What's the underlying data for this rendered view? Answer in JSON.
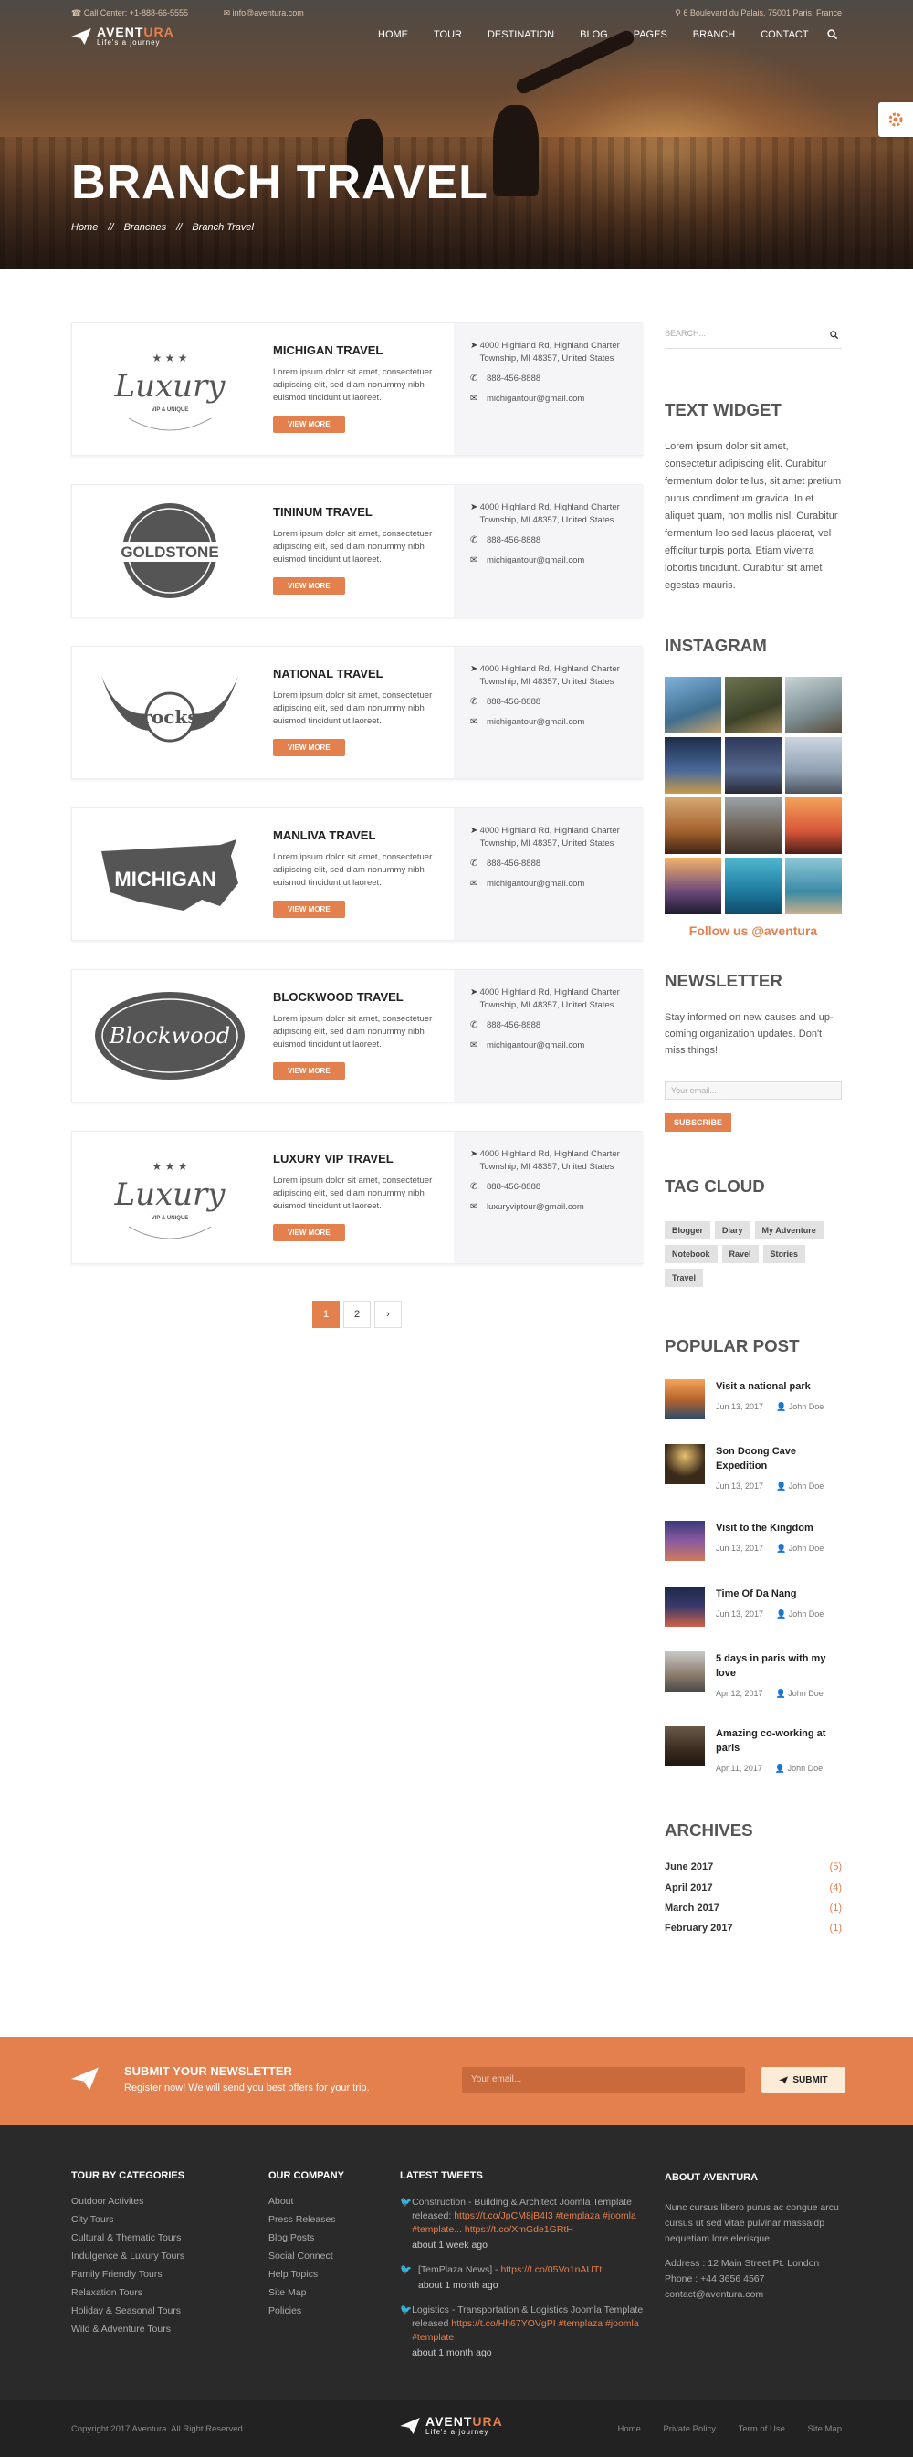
{
  "topbar": {
    "call": "Call Center: +1-888-66-5555",
    "email": "info@aventura.com",
    "address": "6 Boulevard du Palais, 75001 Paris, France"
  },
  "brand": {
    "name_a": "AVENT",
    "name_b": "URA",
    "tagline": "Life's a journey"
  },
  "menu": [
    "HOME",
    "TOUR",
    "DESTINATION",
    "BLOG",
    "PAGES",
    "BRANCH",
    "CONTACT"
  ],
  "hero": {
    "title": "BRANCH TRAVEL",
    "breadcrumb": [
      "Home",
      "//",
      "Branches",
      "//",
      "Branch Travel"
    ]
  },
  "branches": [
    {
      "name": "MICHIGAN TRAVEL",
      "logo": "Luxury",
      "desc": "Lorem ipsum dolor sit amet, consectetuer adipiscing elit, sed diam nonummy nibh euismod tincidunt ut laoreet.",
      "button": "VIEW MORE",
      "address": "4000 Highland Rd, Highland Charter Township, MI 48357, United States",
      "phone": "888-456-8888",
      "email": "michigantour@gmail.com"
    },
    {
      "name": "TININUM TRAVEL",
      "logo": "GOLDSTONE",
      "desc": "Lorem ipsum dolor sit amet, consectetuer adipiscing elit, sed diam nonummy nibh euismod tincidunt ut laoreet.",
      "button": "VIEW MORE",
      "address": "4000 Highland Rd, Highland Charter Township, MI 48357, United States",
      "phone": "888-456-8888",
      "email": "michigantour@gmail.com"
    },
    {
      "name": "NATIONAL TRAVEL",
      "logo": "rocks",
      "desc": "Lorem ipsum dolor sit amet, consectetuer adipiscing elit, sed diam nonummy nibh euismod tincidunt ut laoreet.",
      "button": "VIEW MORE",
      "address": "4000 Highland Rd, Highland Charter Township, MI 48357, United States",
      "phone": "888-456-8888",
      "email": "michigantour@gmail.com"
    },
    {
      "name": "MANLIVA TRAVEL",
      "logo": "MICHIGAN",
      "desc": "Lorem ipsum dolor sit amet, consectetuer adipiscing elit, sed diam nonummy nibh euismod tincidunt ut laoreet.",
      "button": "VIEW MORE",
      "address": "4000 Highland Rd, Highland Charter Township, MI 48357, United States",
      "phone": "888-456-8888",
      "email": "michigantour@gmail.com"
    },
    {
      "name": "BLOCKWOOD TRAVEL",
      "logo": "Blockwood",
      "desc": "Lorem ipsum dolor sit amet, consectetuer adipiscing elit, sed diam nonummy nibh euismod tincidunt ut laoreet.",
      "button": "VIEW MORE",
      "address": "4000 Highland Rd, Highland Charter Township, MI 48357, United States",
      "phone": "888-456-8888",
      "email": "michigantour@gmail.com"
    },
    {
      "name": "LUXURY VIP TRAVEL",
      "logo": "Luxury",
      "desc": "Lorem ipsum dolor sit amet, consectetuer adipiscing elit, sed diam nonummy nibh euismod tincidunt ut laoreet.",
      "button": "VIEW MORE",
      "address": "4000 Highland Rd, Highland Charter Township, MI 48357, United States",
      "phone": "888-456-8888",
      "email": "luxuryviptour@gmail.com"
    }
  ],
  "pagination": [
    "1",
    "2",
    "›"
  ],
  "sidebar": {
    "search_placeholder": "SEARCH...",
    "text_widget": {
      "title": "TEXT WIDGET",
      "body": "Lorem ipsum dolor sit amet, consectetur adipiscing elit. Curabitur fermentum dolor tellus, sit amet pretium purus condimentum gravida. In et aliquet quam, non mollis nisl. Curabitur fermentum leo sed lacus placerat, vel efficitur turpis porta. Etiam viverra lobortis tincidunt. Curabitur sit amet egestas mauris."
    },
    "instagram": {
      "title": "INSTAGRAM",
      "follow": "Follow us @aventura"
    },
    "newsletter": {
      "title": "NEWSLETTER",
      "body": "Stay informed on new causes and up-coming organization updates. Don't miss things!",
      "placeholder": "Your email...",
      "button": "SUBSCRIBE"
    },
    "tag_cloud": {
      "title": "TAG CLOUD",
      "tags": [
        "Blogger",
        "Diary",
        "My Adventure",
        "Notebook",
        "Ravel",
        "Stories",
        "Travel"
      ]
    },
    "popular": {
      "title": "POPULAR POST",
      "posts": [
        {
          "title": "Visit a national park",
          "date": "Jun 13, 2017",
          "author": "John Doe"
        },
        {
          "title": "Son Doong Cave Expedition",
          "date": "Jun 13, 2017",
          "author": "John Doe"
        },
        {
          "title": "Visit to the Kingdom",
          "date": "Jun 13, 2017",
          "author": "John Doe"
        },
        {
          "title": "Time Of Da Nang",
          "date": "Jun 13, 2017",
          "author": "John Doe"
        },
        {
          "title": "5 days in paris with my love",
          "date": "Apr 12, 2017",
          "author": "John Doe"
        },
        {
          "title": "Amazing co-working at paris",
          "date": "Apr 11, 2017",
          "author": "John Doe"
        }
      ]
    },
    "archives": {
      "title": "ARCHIVES",
      "items": [
        {
          "month": "June 2017",
          "count": "(5)"
        },
        {
          "month": "April 2017",
          "count": "(4)"
        },
        {
          "month": "March 2017",
          "count": "(1)"
        },
        {
          "month": "February 2017",
          "count": "(1)"
        }
      ]
    }
  },
  "newsletter_band": {
    "title": "SUBMIT YOUR NEWSLETTER",
    "text": "Register now! We will send you best offers for your trip.",
    "placeholder": "Your email...",
    "button": "SUBMIT"
  },
  "footer": {
    "col1": {
      "title": "TOUR BY CATEGORIES",
      "items": [
        "Outdoor Activites",
        "City Tours",
        "Cultural & Thematic Tours",
        "Indulgence & Luxury Tours",
        "Family Friendly Tours",
        "Relaxation Tours",
        "Holiday & Seasonal Tours",
        "Wild & Adventure Tours"
      ]
    },
    "col2": {
      "title": "OUR COMPANY",
      "items": [
        "About",
        "Press Releases",
        "Blog Posts",
        "Social Connect",
        "Help Topics",
        "Site Map",
        "Policies"
      ]
    },
    "col3": {
      "title": "LATEST TWEETS",
      "tweets": [
        {
          "pre": "Construction - Building & Architect Joomla Template released: ",
          "link": "https://t.co/JpCM8jB4I3 #templaza #joomla #template... https://t.co/XmGde1GRtH",
          "ago": "about 1 week ago"
        },
        {
          "pre": "[TemPlaza News] - ",
          "link": "https://t.co/05Vo1nAUTt",
          "ago": "about 1 month ago"
        },
        {
          "pre": "Logistics - Transportation & Logistics Joomla Template released ",
          "link": "https://t.co/Hh67YOVgPI #templaza #joomla #template",
          "ago": "about 1 month ago"
        }
      ]
    },
    "col4": {
      "title": "ABOUT AVENTURA",
      "body": "Nunc cursus libero purus ac congue arcu cursus ut sed vitae pulvinar massaidp nequetiam lore elerisque.",
      "address": "Address : 12 Main Street Pt. London",
      "phone": "Phone : +44 3656 4567",
      "email": "contact@aventura.com"
    }
  },
  "bottom": {
    "copyright": "Copyright 2017 Aventura. All Right Reserved",
    "links": [
      "Home",
      "Private Policy",
      "Term of Use",
      "Site Map"
    ]
  },
  "colors": {
    "accent": "#e47f4e",
    "footer": "#2a2a2a"
  }
}
